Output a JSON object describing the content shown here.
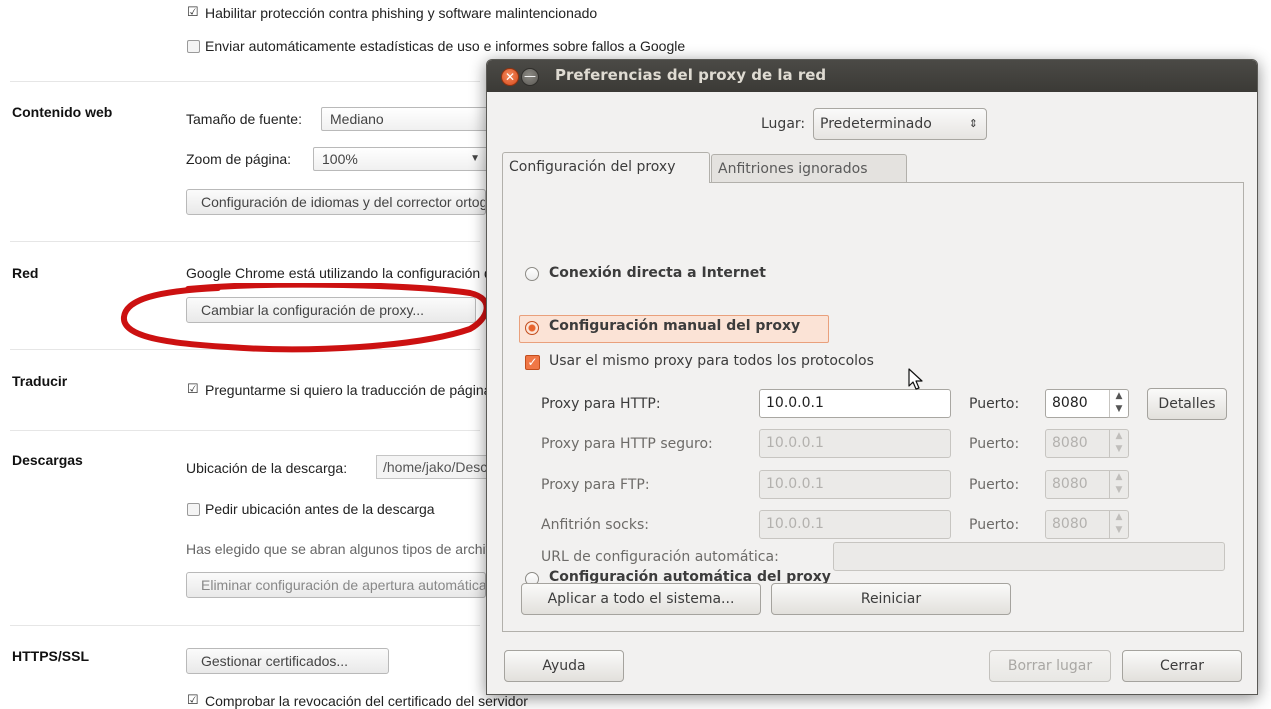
{
  "settings": {
    "top_line_1": "Habilitar protección contra phishing y software malintencionado",
    "top_line_2": "Enviar automáticamente estadísticas de uso e informes sobre fallos a Google",
    "web_content": {
      "title": "Contenido web",
      "font_size_label": "Tamaño de fuente:",
      "font_size_value": "Mediano",
      "zoom_label": "Zoom de página:",
      "zoom_value": "100%",
      "languages_button": "Configuración de idiomas y del corrector ortográfico..."
    },
    "network": {
      "title": "Red",
      "description": "Google Chrome está utilizando la configuración de proxy del sistema",
      "change_proxy_button": "Cambiar la configuración de proxy..."
    },
    "translate": {
      "title": "Traducir",
      "offer_translate": "Preguntarme si quiero la traducción de páginas"
    },
    "downloads": {
      "title": "Descargas",
      "location_label": "Ubicación de la descarga:",
      "location_value": "/home/jako/Descargas",
      "ask_location": "Pedir ubicación antes de la descarga",
      "auto_open_note": "Has elegido que se abran algunos tipos de archivos",
      "clear_auto_open_button": "Eliminar configuración de apertura automática"
    },
    "https": {
      "title": "HTTPS/SSL",
      "manage_certs_button": "Gestionar certificados...",
      "check_revocation": "Comprobar la revocación del certificado del servidor"
    }
  },
  "dialog": {
    "title": "Preferencias del proxy de la red",
    "location_label": "Lugar:",
    "location_value": "Predeterminado",
    "tabs": [
      {
        "label": "Configuración del proxy",
        "active": true
      },
      {
        "label": "Anfitriones ignorados",
        "active": false
      }
    ],
    "direct_connection": "Conexión directa a Internet",
    "manual_proxy": "Configuración manual del proxy",
    "same_proxy_all": "Usar el mismo proxy para todos los protocolos",
    "port_label": "Puerto:",
    "proxies": [
      {
        "label": "Proxy para HTTP:",
        "host": "10.0.0.1",
        "port": "8080",
        "enabled": true
      },
      {
        "label": "Proxy para HTTP seguro:",
        "host": "10.0.0.1",
        "port": "8080",
        "enabled": false
      },
      {
        "label": "Proxy para FTP:",
        "host": "10.0.0.1",
        "port": "8080",
        "enabled": false
      },
      {
        "label": "Anfitrión socks:",
        "host": "10.0.0.1",
        "port": "8080",
        "enabled": false
      }
    ],
    "details_button": "Detalles",
    "auto_proxy": "Configuración automática del proxy",
    "auto_url_label": "URL de configuración automática:",
    "auto_url_value": "",
    "apply_system_button": "Aplicar a todo el sistema...",
    "reset_button": "Reiniciar",
    "help_button": "Ayuda",
    "delete_location_button": "Borrar lugar",
    "close_button": "Cerrar"
  },
  "colors": {
    "accent": "#e8642d",
    "titlebar": "#3c3b37",
    "annotation": "#cc1111"
  },
  "icons": {
    "window_close": "close-icon",
    "window_minimize": "minimize-icon",
    "pointer": "mouse-cursor-icon"
  }
}
